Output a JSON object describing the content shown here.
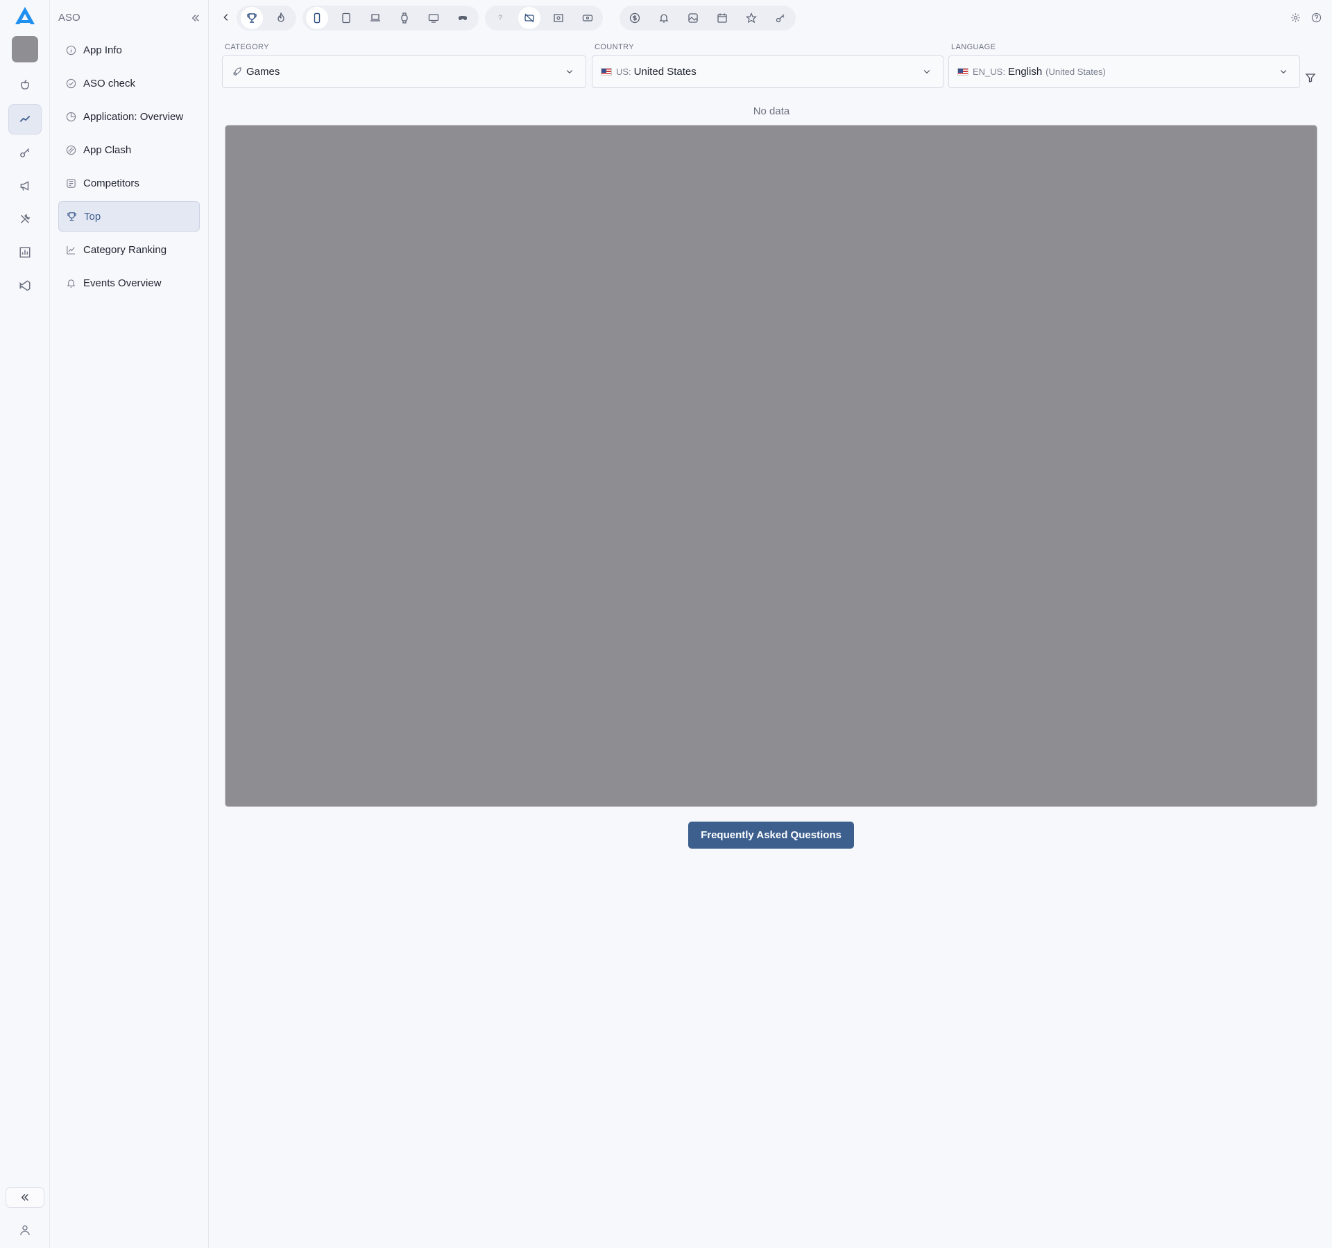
{
  "sidebar": {
    "title": "ASO",
    "items": [
      {
        "label": "App Info",
        "icon": "info-icon"
      },
      {
        "label": "ASO check",
        "icon": "check-circle-icon"
      },
      {
        "label": "Application: Overview",
        "icon": "pie-chart-icon"
      },
      {
        "label": "App Clash",
        "icon": "clash-icon"
      },
      {
        "label": "Competitors",
        "icon": "competitors-icon"
      },
      {
        "label": "Top",
        "icon": "trophy-icon",
        "active": true
      },
      {
        "label": "Category Ranking",
        "icon": "line-chart-icon"
      },
      {
        "label": "Events Overview",
        "icon": "bell-icon"
      }
    ]
  },
  "rail": {
    "icons": [
      "logo-icon",
      "app-thumbnail",
      "apple-icon",
      "trend-icon",
      "key-icon",
      "megaphone-icon",
      "tools-icon",
      "analytics-icon",
      "vscode-icon"
    ],
    "active": "trend-icon"
  },
  "toolbar": {
    "icons": [
      "back-icon",
      "trophy-icon",
      "fire-icon",
      "phone-icon",
      "tablet-icon",
      "laptop-icon",
      "watch-icon",
      "tv-icon",
      "vision-icon",
      "question-icon",
      "no-ads-icon",
      "money-icon",
      "ticket-icon",
      "dollar-icon",
      "bell-icon",
      "image-icon",
      "calendar-icon",
      "star-icon",
      "key-icon",
      "settings-icon",
      "help-icon"
    ],
    "question_mark": "?"
  },
  "filters": {
    "category": {
      "label": "CATEGORY",
      "value": "Games"
    },
    "country": {
      "label": "COUNTRY",
      "code": "US:",
      "value": "United States"
    },
    "language": {
      "label": "LANGUAGE",
      "code": "EN_US:",
      "value": "English",
      "sub": "(United States)"
    }
  },
  "main": {
    "no_data": "No data",
    "faq_label": "Frequently Asked Questions"
  },
  "colors": {
    "accent": "#3c5f8e",
    "active_bg": "#e4e8f3",
    "panel": "#8e8d92",
    "logo": "#1f8ff0"
  }
}
